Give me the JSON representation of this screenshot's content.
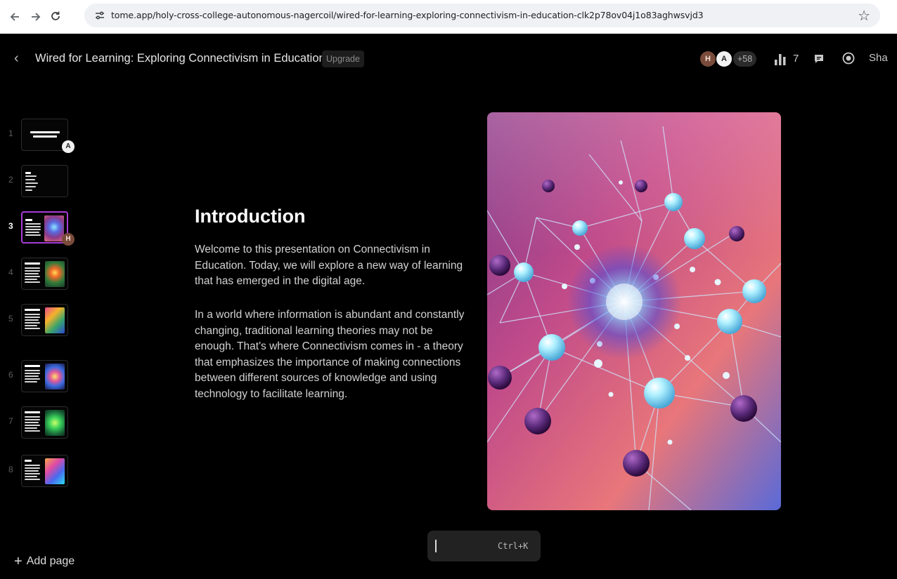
{
  "browser": {
    "url": "tome.app/holy-cross-college-autonomous-nagercoil/wired-for-learning-exploring-connectivism-in-education-clk2p78ov04j1o83aghwsvjd3",
    "icons": [
      "arrow-left-icon",
      "arrow-right-icon",
      "reload-icon",
      "site-settings-icon",
      "star-icon"
    ]
  },
  "appbar": {
    "title": "Wired for Learning: Exploring Connectivism in Education",
    "upgrade_label": "Upgrade",
    "avatars": [
      "H",
      "A"
    ],
    "extra_viewers": "+58",
    "stats_count": "7",
    "share_label": "Sha"
  },
  "sidebar": {
    "pages": [
      {
        "number": "1",
        "badge": "A"
      },
      {
        "number": "2",
        "badge": ""
      },
      {
        "number": "3",
        "badge": "H",
        "active": true
      },
      {
        "number": "4",
        "badge": ""
      },
      {
        "number": "5",
        "badge": ""
      },
      {
        "number": "6",
        "badge": ""
      },
      {
        "number": "7",
        "badge": ""
      },
      {
        "number": "8",
        "badge": ""
      }
    ],
    "add_page_label": "Add page"
  },
  "slide": {
    "title": "Introduction",
    "paragraph_1": "Welcome to this presentation on Connectivism in Education. Today, we will explore a new way of learning that has emerged in the digital age.",
    "paragraph_2": "In a world where information is abundant and constantly changing, traditional learning theories may not be enough. That's where Connectivism comes in - a theory that emphasizes the importance of making connections between different sources of knowledge and using technology to facilitate learning."
  },
  "command_bar": {
    "shortcut": "Ctrl+K"
  },
  "colors": {
    "background": "#000000",
    "active_thumb_border": "#a83bd6",
    "text": "#d2d2d2"
  }
}
